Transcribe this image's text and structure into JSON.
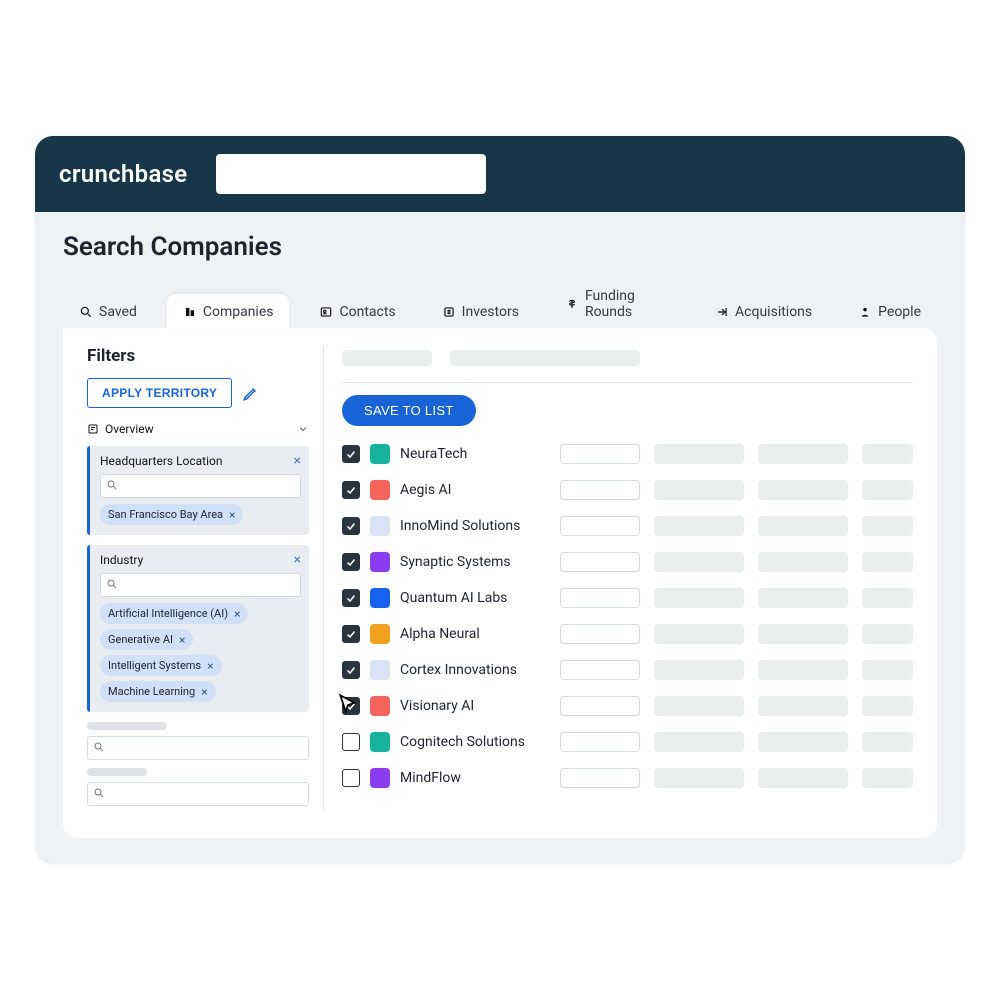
{
  "brand": "crunchbase",
  "page_title": "Search Companies",
  "tabs": [
    {
      "icon": "search",
      "label": "Saved"
    },
    {
      "icon": "company",
      "label": "Companies",
      "active": true
    },
    {
      "icon": "contact",
      "label": "Contacts"
    },
    {
      "icon": "investor",
      "label": "Investors"
    },
    {
      "icon": "funding",
      "label": "Funding Rounds"
    },
    {
      "icon": "acq",
      "label": "Acquisitions"
    },
    {
      "icon": "person",
      "label": "People"
    }
  ],
  "filters": {
    "heading": "Filters",
    "apply_territory_label": "APPLY TERRITORY",
    "overview_label": "Overview",
    "groups": [
      {
        "title": "Headquarters Location",
        "chips": [
          "San Francisco Bay Area"
        ]
      },
      {
        "title": "Industry",
        "chips": [
          "Artificial Intelligence (AI)",
          "Generative AI",
          "Intelligent Systems",
          "Machine Learning"
        ]
      }
    ]
  },
  "save_to_list_label": "SAVE TO LIST",
  "companies": [
    {
      "checked": true,
      "color": "#17b29c",
      "name": "NeuraTech"
    },
    {
      "checked": true,
      "color": "#f5655c",
      "name": "Aegis AI"
    },
    {
      "checked": true,
      "color": "#dbe3f7",
      "name": "InnoMind Solutions"
    },
    {
      "checked": true,
      "color": "#8a3cf0",
      "name": "Synaptic Systems"
    },
    {
      "checked": true,
      "color": "#1864f0",
      "name": "Quantum AI Labs"
    },
    {
      "checked": true,
      "color": "#f2a020",
      "name": "Alpha Neural"
    },
    {
      "checked": true,
      "color": "#dbe3f7",
      "name": "Cortex Innovations"
    },
    {
      "checked": true,
      "color": "#f5655c",
      "name": "Visionary AI",
      "cursor": true
    },
    {
      "checked": false,
      "color": "#17b29c",
      "name": "Cognitech Solutions"
    },
    {
      "checked": false,
      "color": "#8a3cf0",
      "name": "MindFlow"
    }
  ]
}
